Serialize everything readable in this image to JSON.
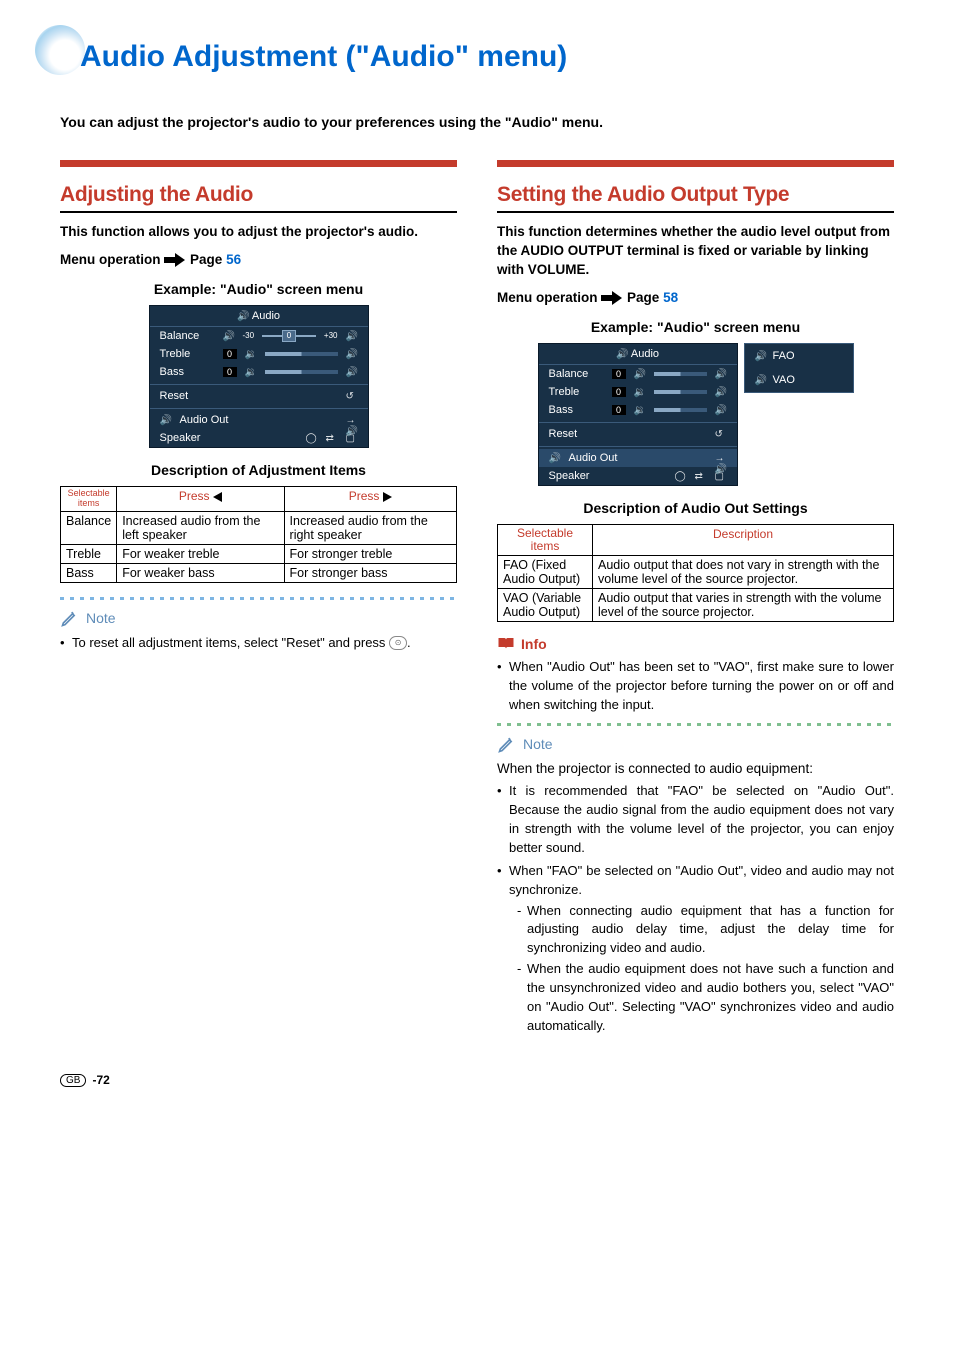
{
  "page": {
    "title": "Audio Adjustment (\"Audio\" menu)",
    "intro": "You can adjust the projector's audio to your preferences using the \"Audio\" menu.",
    "footer_region": "GB",
    "footer_page": "-72"
  },
  "left": {
    "heading": "Adjusting the Audio",
    "body": "This function allows you to adjust the projector's audio.",
    "menu_op_label": "Menu operation",
    "menu_op_page_label": "Page",
    "menu_op_page": "56",
    "example_heading": "Example: \"Audio\" screen menu",
    "osd": {
      "title": "Audio",
      "balance": "Balance",
      "balance_min": "-30",
      "balance_val": "0",
      "balance_max": "+30",
      "treble": "Treble",
      "treble_val": "0",
      "bass": "Bass",
      "bass_val": "0",
      "reset": "Reset",
      "audio_out": "Audio Out",
      "speaker": "Speaker"
    },
    "desc_heading": "Description of Adjustment Items",
    "table": {
      "h_sel": "Selectable items",
      "h_left": "Press",
      "h_right": "Press",
      "rows": [
        {
          "item": "Balance",
          "l": "Increased audio from the left speaker",
          "r": "Increased audio from the right speaker"
        },
        {
          "item": "Treble",
          "l": "For weaker treble",
          "r": "For stronger treble"
        },
        {
          "item": "Bass",
          "l": "For weaker bass",
          "r": "For stronger bass"
        }
      ]
    },
    "note_label": "Note",
    "note_bullet_a": "To reset all adjustment items, select \"Reset\" and press ",
    "note_bullet_b": "."
  },
  "right": {
    "heading": "Setting the Audio Output Type",
    "body": "This function determines whether the audio level output from the AUDIO OUTPUT terminal is fixed or variable by linking with VOLUME.",
    "menu_op_label": "Menu operation",
    "menu_op_page_label": "Page",
    "menu_op_page": "58",
    "example_heading": "Example: \"Audio\" screen menu",
    "osd": {
      "title": "Audio",
      "balance": "Balance",
      "balance_val": "0",
      "treble": "Treble",
      "treble_val": "0",
      "bass": "Bass",
      "bass_val": "0",
      "reset": "Reset",
      "audio_out": "Audio Out",
      "speaker": "Speaker",
      "opt_fao": "FAO",
      "opt_vao": "VAO"
    },
    "desc_heading": "Description of Audio Out Settings",
    "table": {
      "h_sel": "Selectable items",
      "h_desc": "Description",
      "rows": [
        {
          "item": "FAO (Fixed Audio Output)",
          "desc": "Audio output that does not vary in strength with the volume level of the source projector."
        },
        {
          "item": "VAO (Variable Audio Output)",
          "desc": "Audio output that varies in strength with the volume level of the source projector."
        }
      ]
    },
    "info_label": "Info",
    "info_bullet": "When \"Audio Out\" has been set to \"VAO\", first make sure to lower the volume of the projector before turning the power on or off and when switching the input.",
    "note_label": "Note",
    "note_intro": "When the projector is connected to audio equipment:",
    "note_b1": "It is recommended that \"FAO\" be selected on \"Audio Out\". Because the audio signal from the audio equipment does not vary in strength with the volume level of the projector, you can enjoy better sound.",
    "note_b2": "When \"FAO\" be selected on \"Audio Out\", video and audio may not synchronize.",
    "note_b2_d1": "When connecting audio equipment that has a function for adjusting audio delay time, adjust the delay time for synchronizing video and audio.",
    "note_b2_d2": "When the audio equipment does not have such a function and the unsynchronized video and audio bothers you, select \"VAO\" on \"Audio Out\". Selecting \"VAO\" synchronizes video and audio automatically."
  }
}
